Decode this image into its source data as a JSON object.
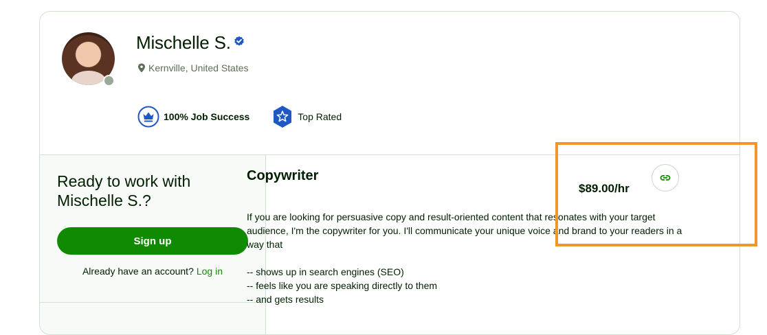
{
  "profile": {
    "name": "Mischelle S.",
    "location": "Kernville, United States",
    "badges": [
      {
        "label": "100% Job Success",
        "icon": "crown-icon"
      },
      {
        "label": "Top Rated",
        "icon": "star-badge-icon"
      }
    ]
  },
  "sidebar": {
    "heading": "Ready to work with Mischelle S.?",
    "signup_label": "Sign up",
    "account_text": "Already have an account?",
    "login_label": "Log in"
  },
  "main": {
    "title": "Copywriter",
    "rate": "$89.00/hr",
    "bio_lines": [
      "If you are looking for persuasive copy and result-oriented content that resonates with your target audience, I'm the copywriter for you. I'll communicate your unique voice and brand to your readers in a way that",
      "",
      "-- shows up in search engines (SEO)",
      "-- feels like you are speaking directly to them",
      "-- and gets results"
    ]
  },
  "colors": {
    "brand_green": "#108a00",
    "verified_blue": "#1f57c3",
    "highlight_orange": "#f0962b"
  }
}
